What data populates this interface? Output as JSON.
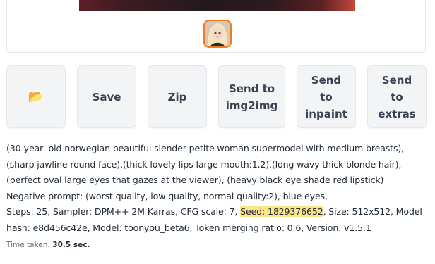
{
  "gallery": {
    "main_image_alt": "generated image",
    "thumbnail_alt": "thumbnail"
  },
  "buttons": {
    "folder_icon": "📂",
    "save": "Save",
    "zip": "Zip",
    "send_img2img": "Send to\nimg2img",
    "send_inpaint": "Send\nto\ninpaint",
    "send_extras": "Send\nto\nextras"
  },
  "info": {
    "prompt": "(30-year- old norwegian beautiful slender petite woman supermodel with medium breasts),(sharp jawline round face),(thick lovely lips large mouth:1.2),(long wavy thick blonde hair), (perfect oval large eyes that gazes at the viewer), (heavy black eye shade red lipstick)",
    "negative_prompt": "Negative prompt: (worst quality, low quality, normal quality:2), blue eyes,",
    "params_before": "Steps: 25, Sampler: DPM++ 2M Karras, CFG scale: 7, ",
    "seed": "Seed: 1829376652",
    "params_after": ", Size: 512x512, Model hash: e8d456c42e, Model: toonyou_beta6, Token merging ratio: 0.6, Version: v1.5.1"
  },
  "time": {
    "label": "Time taken: ",
    "value": "30.5 sec."
  },
  "colors": {
    "thumb_border": "#f07b22",
    "seed_highlight": "#fde68a"
  }
}
